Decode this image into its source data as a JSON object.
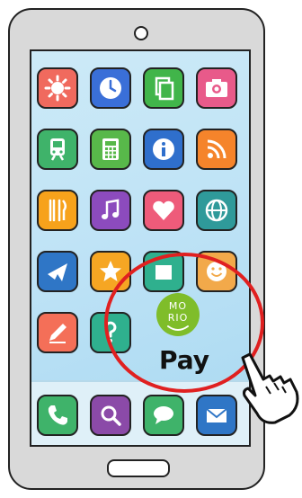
{
  "apps": [
    {
      "icon": "sun-icon",
      "color": "#f06a5e"
    },
    {
      "icon": "clock-icon",
      "color": "#3a6fd8"
    },
    {
      "icon": "documents-icon",
      "color": "#41b54a"
    },
    {
      "icon": "camera-icon",
      "color": "#e85a8a"
    },
    {
      "icon": "train-icon",
      "color": "#3fb36a"
    },
    {
      "icon": "calculator-icon",
      "color": "#58b84a"
    },
    {
      "icon": "info-icon",
      "color": "#2f6fcc"
    },
    {
      "icon": "rss-icon",
      "color": "#f5842b"
    },
    {
      "icon": "fork-knife-icon",
      "color": "#f7a21b"
    },
    {
      "icon": "music-note-icon",
      "color": "#8c4bbd"
    },
    {
      "icon": "heart-icon",
      "color": "#ee5b7a"
    },
    {
      "icon": "globe-icon",
      "color": "#2f9a9a"
    },
    {
      "icon": "airplane-icon",
      "color": "#2f76c6"
    },
    {
      "icon": "star-icon",
      "color": "#f6a623"
    },
    {
      "icon": "app-icon",
      "color": "#2fb08e"
    },
    {
      "icon": "smiley-icon",
      "color": "#f2a94a"
    },
    {
      "icon": "pencil-icon",
      "color": "#f46f58"
    },
    {
      "icon": "question-icon",
      "color": "#2fb08e"
    }
  ],
  "dock": [
    {
      "icon": "phone-icon",
      "color": "#3fb36a"
    },
    {
      "icon": "search-icon",
      "color": "#8b4aa8"
    },
    {
      "icon": "chat-icon",
      "color": "#3fb36a"
    },
    {
      "icon": "mail-icon",
      "color": "#2f76c6"
    }
  ],
  "pay_app": {
    "logo_line1": "MO",
    "logo_line2": "RIO",
    "label": "Pay",
    "logo_color": "#7fbd2a",
    "highlight_color": "#e02020"
  }
}
